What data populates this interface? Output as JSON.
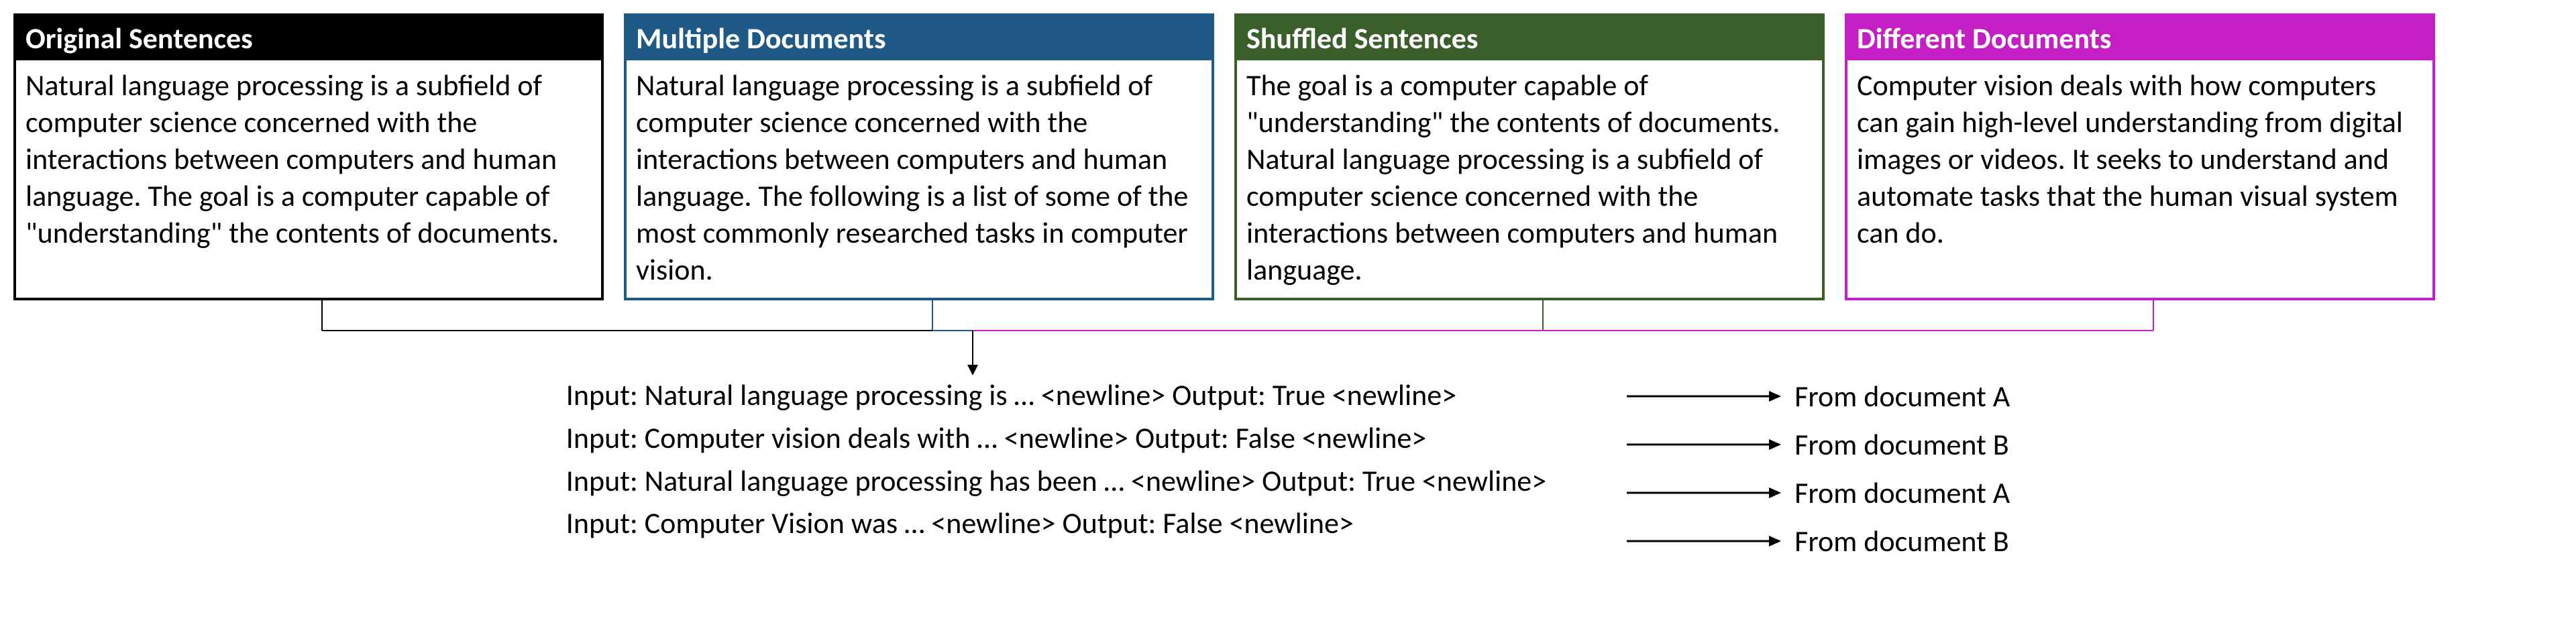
{
  "boxes": [
    {
      "title": "Original Sentences",
      "body": "Natural language processing is a subfield of computer science concerned with the interactions between computers and human language. The goal is a computer capable of \"understanding\" the contents of documents."
    },
    {
      "title": "Multiple Documents",
      "body": "Natural language processing is a subfield of computer science concerned with the interactions between computers and human language. The following is a list of some of the most commonly researched tasks in computer vision."
    },
    {
      "title": "Shuffled Sentences",
      "body": "The goal is a computer capable of \"understanding\" the contents of documents. Natural language processing is a subfield of computer science concerned with the interactions between computers and human language."
    },
    {
      "title": "Different Documents",
      "body": "Computer vision deals with how computers can gain high-level understanding from digital images or videos. It seeks to understand and automate tasks that the human visual system can do."
    }
  ],
  "io_lines": [
    "Input: Natural language processing is … <newline> Output: True <newline>",
    "Input: Computer vision deals with … <newline> Output: False <newline>",
    "Input: Natural language processing has been … <newline> Output: True <newline>",
    "Input: Computer Vision was … <newline> Output: False <newline>"
  ],
  "arrow_labels": [
    "From document A",
    "From document B",
    "From document A",
    "From document B"
  ]
}
